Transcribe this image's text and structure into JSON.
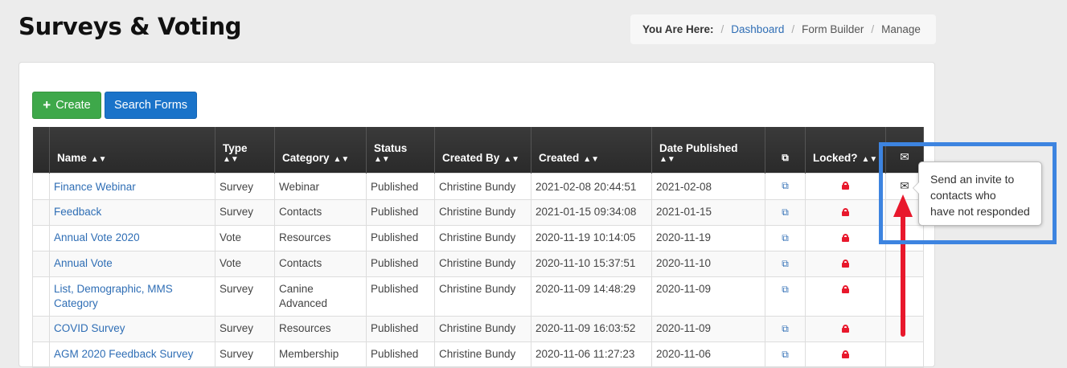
{
  "page": {
    "title": "Surveys & Voting"
  },
  "breadcrumb": {
    "label": "You Are Here:",
    "items": [
      "Dashboard",
      "Form Builder",
      "Manage"
    ]
  },
  "toolbar": {
    "create_label": "Create",
    "search_label": "Search Forms"
  },
  "table": {
    "columns": {
      "name": "Name",
      "type": "Type",
      "category": "Category",
      "status": "Status",
      "created_by": "Created By",
      "created": "Created",
      "date_published": "Date Published",
      "locked": "Locked?"
    },
    "rows": [
      {
        "name": "Finance Webinar",
        "type": "Survey",
        "category": "Webinar",
        "status": "Published",
        "created_by": "Christine Bundy",
        "created": "2021-02-08 20:44:51",
        "date_published": "2021-02-08"
      },
      {
        "name": "Feedback",
        "type": "Survey",
        "category": "Contacts",
        "status": "Published",
        "created_by": "Christine Bundy",
        "created": "2021-01-15 09:34:08",
        "date_published": "2021-01-15"
      },
      {
        "name": "Annual Vote 2020",
        "type": "Vote",
        "category": "Resources",
        "status": "Published",
        "created_by": "Christine Bundy",
        "created": "2020-11-19 10:14:05",
        "date_published": "2020-11-19"
      },
      {
        "name": "Annual Vote",
        "type": "Vote",
        "category": "Contacts",
        "status": "Published",
        "created_by": "Christine Bundy",
        "created": "2020-11-10 15:37:51",
        "date_published": "2020-11-10"
      },
      {
        "name": "List, Demographic, MMS Category",
        "type": "Survey",
        "category": "Canine Advanced",
        "status": "Published",
        "created_by": "Christine Bundy",
        "created": "2020-11-09 14:48:29",
        "date_published": "2020-11-09"
      },
      {
        "name": "COVID Survey",
        "type": "Survey",
        "category": "Resources",
        "status": "Published",
        "created_by": "Christine Bundy",
        "created": "2020-11-09 16:03:52",
        "date_published": "2020-11-09"
      },
      {
        "name": "AGM 2020 Feedback Survey",
        "type": "Survey",
        "category": "Membership",
        "status": "Published",
        "created_by": "Christine Bundy",
        "created": "2020-11-06 11:27:23",
        "date_published": "2020-11-06"
      }
    ]
  },
  "tooltip": {
    "lines": [
      "Send an invite to",
      "contacts who",
      "have not responded"
    ]
  },
  "colors": {
    "highlight": "#3d84e0",
    "arrow": "#e8182c",
    "link": "#2f6eb5",
    "lock": "#e8182c"
  },
  "icons": {
    "copy": "copy-icon",
    "lock": "lock-icon",
    "invite": "envelope-icon"
  }
}
